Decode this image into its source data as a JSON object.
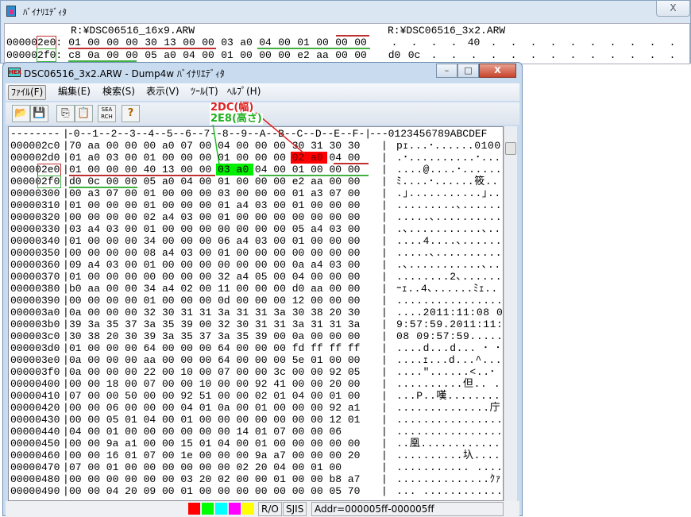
{
  "back_window": {
    "title": "ﾊﾞｲﾅﾘｴﾃﾞｨﾀ",
    "close_label": "X",
    "file_left": "R:¥DSC06516_16x9.ARW",
    "file_right": "R:¥DSC06516_3x2.ARW",
    "rows": [
      {
        "addr_prefix": "00000",
        "addr_hl": "2e0",
        "colon": ":",
        "bytes": [
          "01",
          "00",
          "00",
          "00",
          "30",
          "13",
          "00",
          "00",
          "03",
          "a0",
          "04",
          "00",
          "01",
          "00",
          "00",
          "00"
        ],
        "compare": [
          ".",
          ".",
          ".",
          ".",
          "40",
          ".",
          ".",
          ".",
          ".",
          ".",
          ".",
          ".",
          ".",
          ".",
          ".",
          "."
        ]
      },
      {
        "addr_prefix": "00000",
        "addr_hl": "2f0",
        "colon": ":",
        "bytes": [
          "c8",
          "0a",
          "00",
          "00",
          "05",
          "a0",
          "04",
          "00",
          "01",
          "00",
          "00",
          "00",
          "e2",
          "aa",
          "00",
          "00"
        ],
        "compare": [
          "d0",
          "0c",
          ".",
          ".",
          ".",
          ".",
          ".",
          ".",
          ".",
          ".",
          ".",
          ".",
          ".",
          ".",
          ".",
          "."
        ]
      }
    ]
  },
  "front_window": {
    "title": "DSC06516_3x2.ARW - Dump4w ﾊﾞｲﾅﾘｴﾃﾞｨﾀ",
    "icon_label": "HEX",
    "minimize": "–",
    "maximize": "□",
    "close": "X",
    "menu": [
      "ﾌｧｲﾙ(F)",
      "編集(E)",
      "検索(S)",
      "表示(V)",
      "ﾂｰﾙ(T)",
      "ﾍﾙﾌﾟ(H)"
    ],
    "toolbar": {
      "open": "📂",
      "save": "💾",
      "copy": "⎘",
      "paste": "📋",
      "search": "SEA RCH",
      "help": "?"
    },
    "annotations": {
      "width": "2DC(幅)",
      "height": "2E8(高さ)"
    },
    "colors": {
      "red": "#ff0000",
      "green": "#00ee00",
      "note_red": "#e02020",
      "note_green": "#20b020"
    },
    "header": {
      "addr": "--------",
      "sep": "|",
      "cols": [
        "-0-",
        "-1-",
        "-2-",
        "-3-",
        "-4-",
        "-5-",
        "-6-",
        "-7-",
        "-8-",
        "-9-",
        "-A-",
        "-B-",
        "-C-",
        "-D-",
        "-E-",
        "-F-"
      ],
      "sep2": "|",
      "ascii": "---0123456789ABCDEF"
    },
    "rows": [
      {
        "addr": "000002c0",
        "hex": "70 aa 00 00 00 a0 07 00 04 00 00 00 30 31 30 30",
        "ascii": "pｪ...･......0100"
      },
      {
        "addr": "000002d0",
        "hex": "01 a0 03 00 01 00 00 00 01 00 00 00 02 a0 04 00",
        "ascii": ".･..........･..."
      },
      {
        "addr": "000002e0",
        "hex": "01 00 00 00 40 13 00 00 03 a0 04 00 01 00 00 00",
        "ascii": "....@....･......"
      },
      {
        "addr": "000002f0",
        "hex": "d0 0c 00 00 05 a0 04 00 01 00 00 00 e2 aa 00 00",
        "ascii": "ﾐ....･......筱.."
      },
      {
        "addr": "00000300",
        "hex": "00 a3 07 00 01 00 00 00 03 00 00 00 01 a3 07 00",
        "ascii": ".｣...........｣.."
      },
      {
        "addr": "00000310",
        "hex": "01 00 00 00 01 00 00 00 01 a4 03 00 01 00 00 00",
        "ascii": ".........､......"
      },
      {
        "addr": "00000320",
        "hex": "00 00 00 00 02 a4 03 00 01 00 00 00 00 00 00 00",
        "ascii": ".....､.........."
      },
      {
        "addr": "00000330",
        "hex": "03 a4 03 00 01 00 00 00 00 00 00 00 05 a4 03 00",
        "ascii": ".､...........､.."
      },
      {
        "addr": "00000340",
        "hex": "01 00 00 00 34 00 00 00 06 a4 03 00 01 00 00 00",
        "ascii": "....4....､......"
      },
      {
        "addr": "00000350",
        "hex": "00 00 00 00 08 a4 03 00 01 00 00 00 00 00 00 00",
        "ascii": ".....､.........."
      },
      {
        "addr": "00000360",
        "hex": "09 a4 03 00 01 00 00 00 00 00 00 00 0a a4 03 00",
        "ascii": ".､...........､.."
      },
      {
        "addr": "00000370",
        "hex": "01 00 00 00 00 00 00 00 32 a4 05 00 04 00 00 00",
        "ascii": "........2､......"
      },
      {
        "addr": "00000380",
        "hex": "b0 aa 00 00 34 a4 02 00 11 00 00 00 d0 aa 00 00",
        "ascii": "ｰｪ..4､......ﾐｪ.."
      },
      {
        "addr": "00000390",
        "hex": "00 00 00 00 01 00 00 00 0d 00 00 00 12 00 00 00",
        "ascii": "................"
      },
      {
        "addr": "000003a0",
        "hex": "0a 00 00 00 32 30 31 31 3a 31 31 3a 30 38 20 30",
        "ascii": "....2011:11:08 0"
      },
      {
        "addr": "000003b0",
        "hex": "39 3a 35 37 3a 35 39 00 32 30 31 31 3a 31 31 3a",
        "ascii": "9:57:59.2011:11:"
      },
      {
        "addr": "000003c0",
        "hex": "30 38 20 30 39 3a 35 37 3a 35 39 00 0a 00 00 00",
        "ascii": "08 09:57:59....."
      },
      {
        "addr": "000003d0",
        "hex": "01 00 00 00 64 00 00 00 64 00 00 00 fd ff ff ff",
        "ascii": "....d...d... ･ ･"
      },
      {
        "addr": "000003e0",
        "hex": "0a 00 00 00 aa 00 00 00 64 00 00 00 5e 01 00 00",
        "ascii": "....ｪ...d...^..."
      },
      {
        "addr": "000003f0",
        "hex": "0a 00 00 00 22 00 10 00 07 00 00 3c 00 00 92 05",
        "ascii": "....\"......<..･"
      },
      {
        "addr": "00000400",
        "hex": "00 00 18 00 07 00 00 10 00 00 92 41 00 00 20 00",
        "ascii": "..........但.. ."
      },
      {
        "addr": "00000410",
        "hex": "07 00 00 50 00 00 92 51 00 00 02 01 04 00 01 00",
        "ascii": "...P..嘆........"
      },
      {
        "addr": "00000420",
        "hex": "00 00 06 00 00 00 04 01 0a 00 01 00 00 00 92 a1",
        "ascii": "..............庁"
      },
      {
        "addr": "00000430",
        "hex": "00 00 05 01 04 00 01 00 00 00 00 00 00 00 12 01",
        "ascii": "................"
      },
      {
        "addr": "00000440",
        "hex": "04 00 01 00 00 00 00 00 00 14 01 07 00 00 06",
        "ascii": "................"
      },
      {
        "addr": "00000450",
        "hex": "00 00 9a a1 00 00 15 01 04 00 01 00 00 00 00 00",
        "ascii": "..凰............"
      },
      {
        "addr": "00000460",
        "hex": "00 00 16 01 07 00 1e 00 00 00 9a a7 00 00 00 20",
        "ascii": "..........圦...."
      },
      {
        "addr": "00000470",
        "hex": "07 00 01 00 00 00 00 00 00 02 20 04 00 01 00",
        "ascii": "........... ...."
      },
      {
        "addr": "00000480",
        "hex": "00 00 00 00 00 00 03 20 02 00 00 01 00 00 b8 a7",
        "ascii": "..............ｸｧ"
      },
      {
        "addr": "00000490",
        "hex": "00 00 04 20 09 00 01 00 00 00 00 00 00 00 05 70",
        "ascii": "... ............"
      }
    ],
    "status": {
      "swatches": [
        "#ff0000",
        "#00ff00",
        "#00ffff",
        "#ff00ff",
        "#ffff00"
      ],
      "mode": "R/O",
      "encoding": "SJIS",
      "address": "Addr=000005ff-000005ff"
    }
  }
}
